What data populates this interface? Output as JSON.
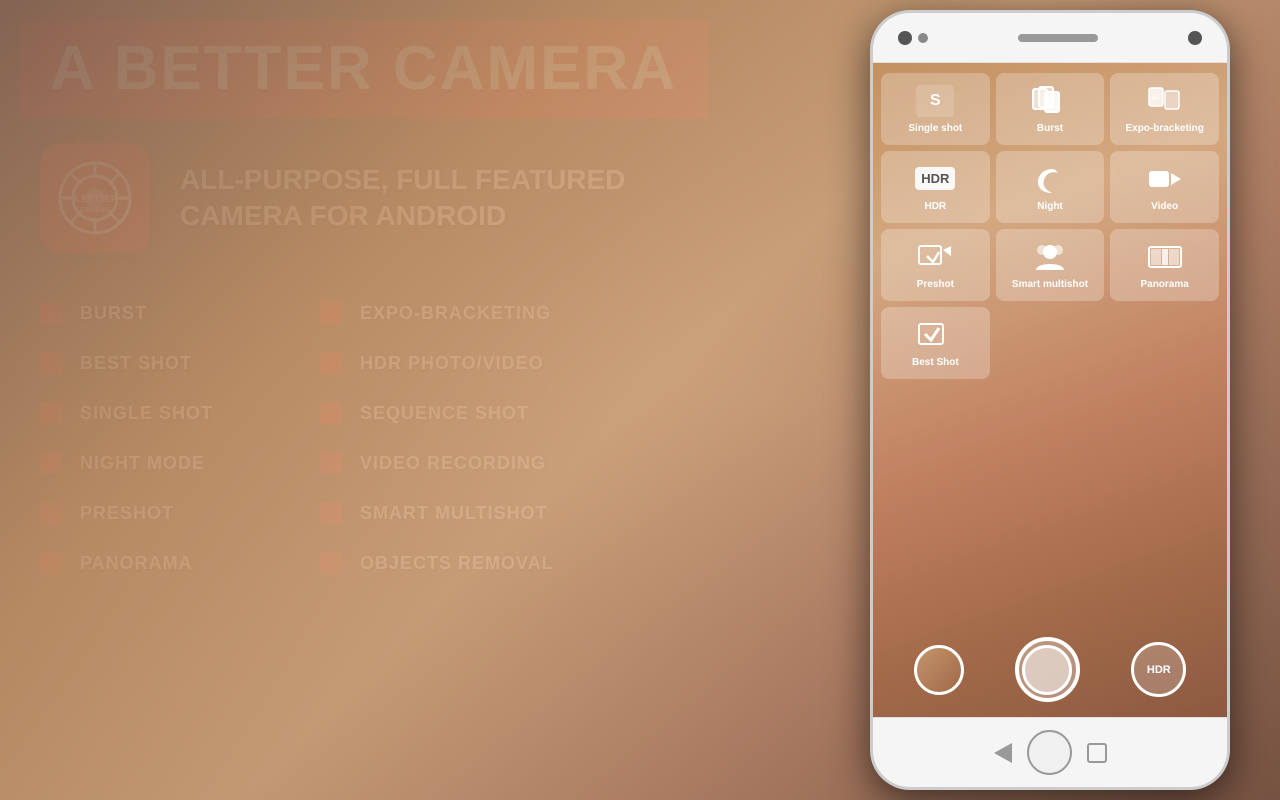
{
  "header": {
    "title": "A BETTER CAMERA",
    "bg_color": "#d32f2f"
  },
  "app": {
    "tagline": "ALL-PURPOSE, FULL FEATURED CAMERA FOR ANDROID",
    "icon_alt": "A Better Camera App Icon"
  },
  "features": {
    "col1": [
      "BURST",
      "BEST SHOT",
      "SINGLE SHOT",
      "NIGHT MODE",
      "PRESHOT",
      "PANORAMA"
    ],
    "col2": [
      "EXPO-BRACKETING",
      "HDR PHOTO/VIDEO",
      "SEQUENCE SHOT",
      "VIDEO RECORDING",
      "SMART MULTISHOT",
      "OBJECTS REMOVAL"
    ]
  },
  "camera_modes": [
    {
      "label": "Single shot",
      "icon": "S"
    },
    {
      "label": "Burst",
      "icon": "⧉"
    },
    {
      "label": "Expo-\nbracketing",
      "icon": "✦"
    },
    {
      "label": "HDR",
      "icon": "HDR"
    },
    {
      "label": "Night",
      "icon": "☽"
    },
    {
      "label": "Video",
      "icon": "🎥"
    },
    {
      "label": "Preshot",
      "icon": "↩"
    },
    {
      "label": "Smart\nmultishot",
      "icon": "👤"
    },
    {
      "label": "Panorama",
      "icon": "▤"
    },
    {
      "label": "Best Shot",
      "icon": "✓"
    }
  ],
  "phone": {
    "bottom_buttons": [
      "◁",
      "●",
      "□"
    ]
  }
}
